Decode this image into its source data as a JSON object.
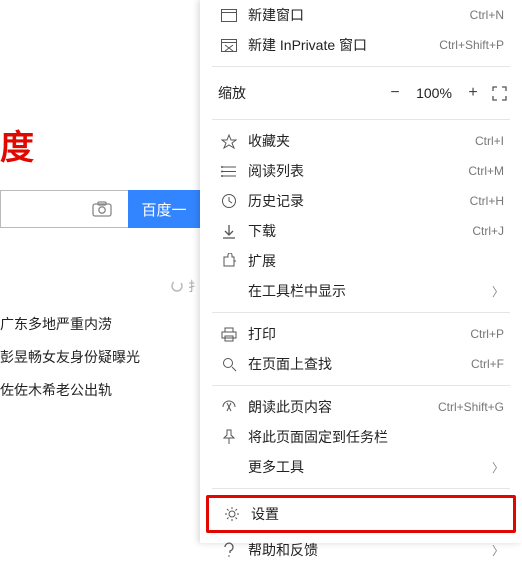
{
  "page": {
    "logo_partial": "度",
    "search_button": "百度一",
    "loading_partial": "扌",
    "news": [
      "广东多地严重内涝",
      "彭昱畅女友身份疑曝光",
      "佐佐木希老公出轨"
    ]
  },
  "menu": {
    "new_window": {
      "label": "新建窗口",
      "shortcut": "Ctrl+N"
    },
    "new_inprivate": {
      "label": "新建 InPrivate 窗口",
      "shortcut": "Ctrl+Shift+P"
    },
    "zoom": {
      "label": "缩放",
      "value": "100%"
    },
    "favorites": {
      "label": "收藏夹",
      "shortcut": "Ctrl+I"
    },
    "reading_list": {
      "label": "阅读列表",
      "shortcut": "Ctrl+M"
    },
    "history": {
      "label": "历史记录",
      "shortcut": "Ctrl+H"
    },
    "downloads": {
      "label": "下载",
      "shortcut": "Ctrl+J"
    },
    "extensions": {
      "label": "扩展"
    },
    "show_in_toolbar": {
      "label": "在工具栏中显示"
    },
    "print": {
      "label": "打印",
      "shortcut": "Ctrl+P"
    },
    "find": {
      "label": "在页面上查找",
      "shortcut": "Ctrl+F"
    },
    "read_aloud": {
      "label": "朗读此页内容",
      "shortcut": "Ctrl+Shift+G"
    },
    "pin_taskbar": {
      "label": "将此页面固定到任务栏"
    },
    "more_tools": {
      "label": "更多工具"
    },
    "settings": {
      "label": "设置"
    },
    "help": {
      "label": "帮助和反馈"
    }
  }
}
